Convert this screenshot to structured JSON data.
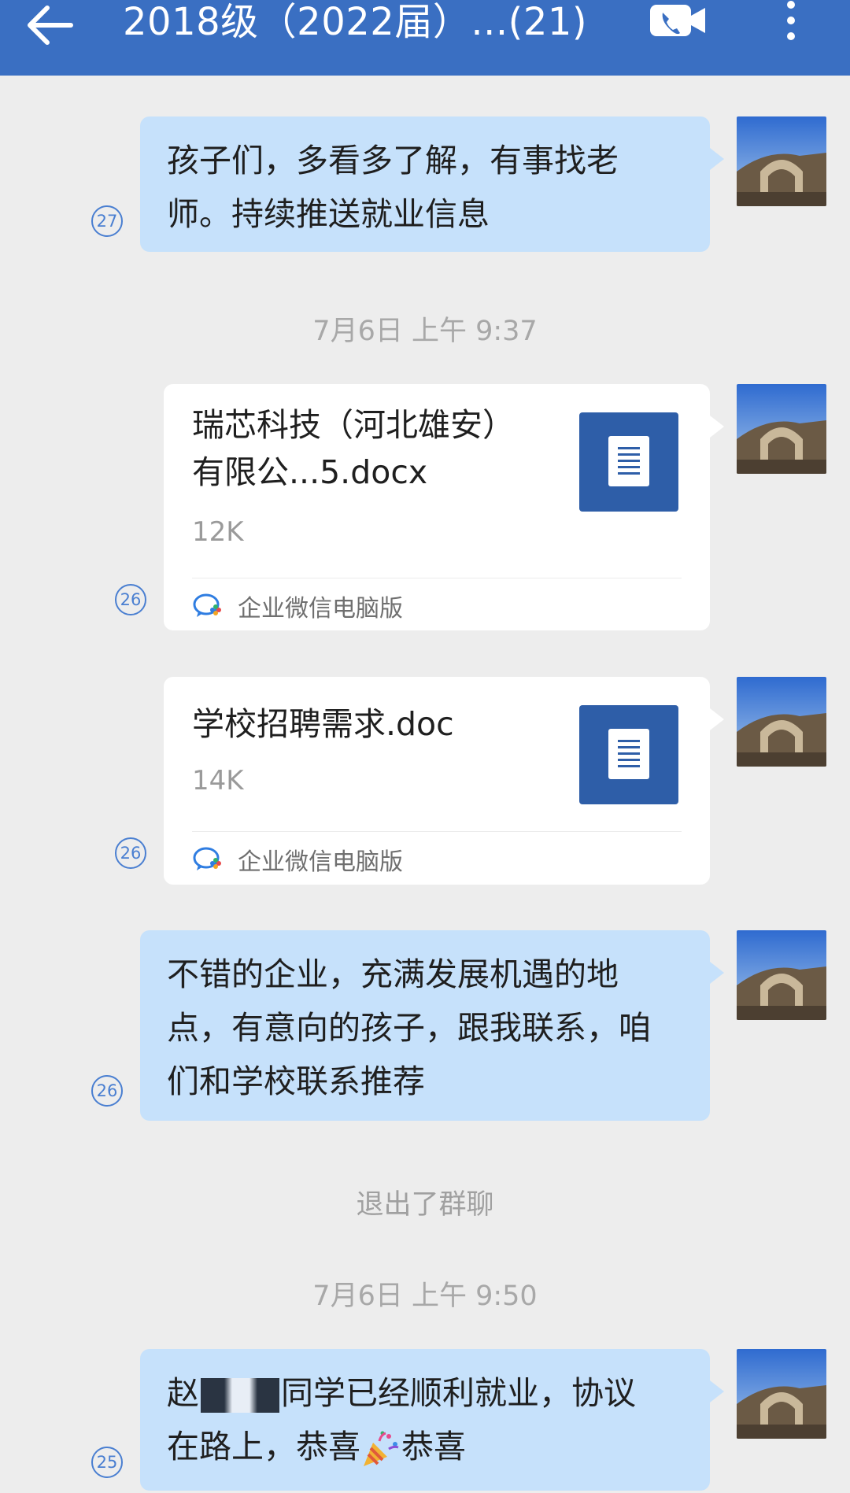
{
  "header": {
    "title": "2018级（2022届）...(21)",
    "back_icon": "back-arrow-icon",
    "video_icon": "video-call-icon",
    "more_icon": "more-vertical-icon",
    "bar_color": "#3a6fc2"
  },
  "messages": [
    {
      "type": "text",
      "text": "孩子们，多看多了解，有事找老师。持续推送就业信息",
      "unread": "27"
    },
    {
      "type": "timestamp",
      "text": "7月6日  上午 9:37"
    },
    {
      "type": "file",
      "filename": "瑞芯科技（河北雄安）有限公...5.docx",
      "size": "12K",
      "source": "企业微信电脑版",
      "unread": "26"
    },
    {
      "type": "file",
      "filename": "学校招聘需求.doc",
      "size": "14K",
      "source": "企业微信电脑版",
      "unread": "26"
    },
    {
      "type": "text",
      "text": "不错的企业，充满发展机遇的地点，有意向的孩子，跟我联系，咱们和学校联系推荐",
      "unread": "26"
    },
    {
      "type": "system",
      "text": "退出了群聊"
    },
    {
      "type": "timestamp",
      "text": "7月6日  上午 9:50"
    },
    {
      "type": "text",
      "text_part1": "赵",
      "text_part2": "同学已经顺利就业，协议",
      "text_part3": "在路上，恭喜",
      "text_part4": "恭喜",
      "unread": "25"
    }
  ],
  "colors": {
    "bubble": "#c6e1fb",
    "background": "#ededed",
    "file_icon": "#2e5ea8",
    "unread_badge": "#4a7fd1"
  }
}
